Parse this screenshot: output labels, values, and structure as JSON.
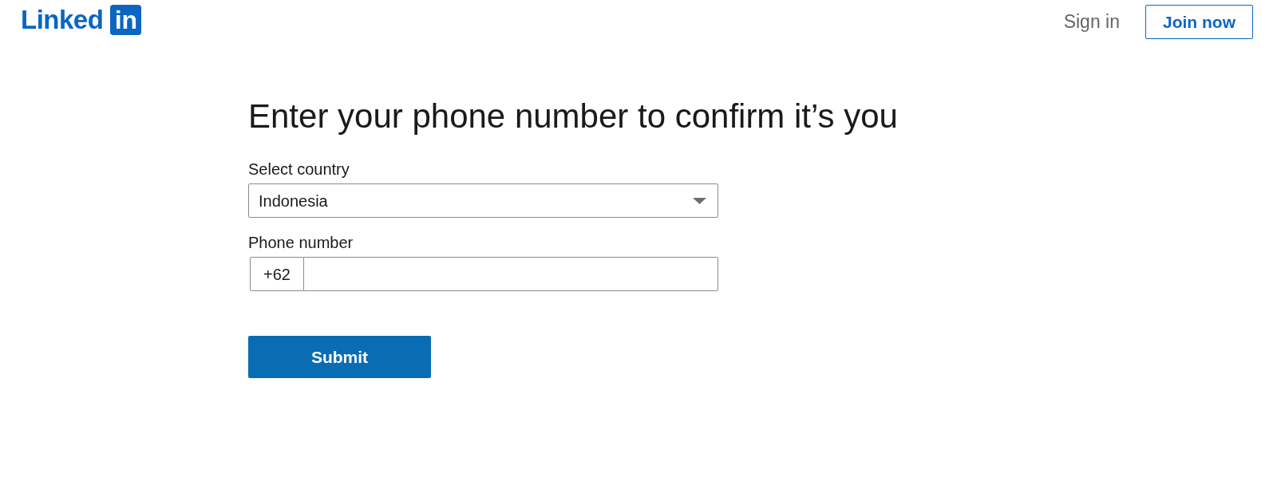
{
  "header": {
    "logo": {
      "word": "Linked",
      "badge": "in"
    },
    "sign_in": "Sign in",
    "join_now": "Join now"
  },
  "form": {
    "title": "Enter your phone number to confirm it’s you",
    "country_label": "Select country",
    "country_value": "Indonesia",
    "phone_label": "Phone number",
    "phone_prefix": "+62",
    "submit": "Submit"
  }
}
